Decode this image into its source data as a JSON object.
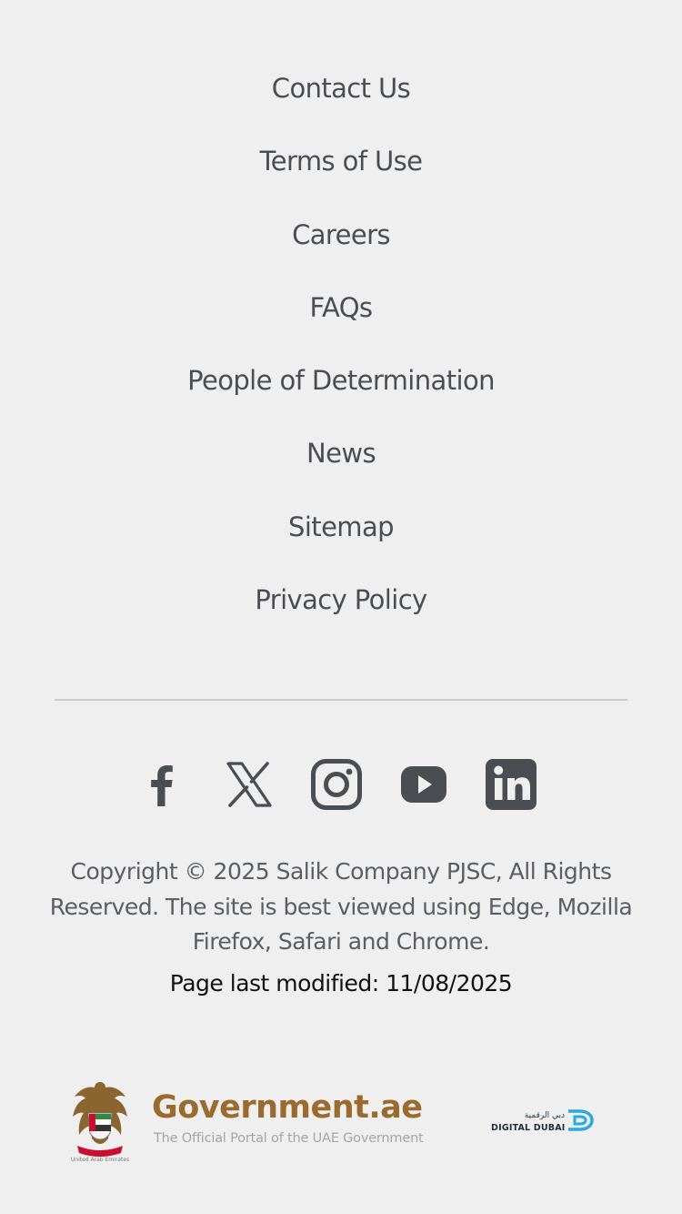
{
  "footer_links": [
    {
      "label": "Contact Us"
    },
    {
      "label": "Terms of Use"
    },
    {
      "label": "Careers"
    },
    {
      "label": "FAQs"
    },
    {
      "label": "People of Determination"
    },
    {
      "label": "News"
    },
    {
      "label": "Sitemap"
    },
    {
      "label": "Privacy Policy"
    }
  ],
  "social": {
    "icons": [
      "facebook-icon",
      "x-icon",
      "instagram-icon",
      "youtube-icon",
      "linkedin-icon"
    ],
    "color": "#4a4d52"
  },
  "copyright": "Copyright © 2025 Salik Company PJSC, All Rights Reserved. The site is best viewed using Edge, Mozilla Firefox, Safari and Chrome.",
  "last_modified": "Page last modified: 11/08/2025",
  "gov_logo": {
    "title": "Government.ae",
    "subtitle": "The Official Portal of the UAE Government",
    "emblem_caption": "United Arab Emirates",
    "color": "#9a6a2e"
  },
  "digital_dubai": {
    "arabic": "دبي الرقمية",
    "label": "DIGITAL DUBAI",
    "color": "#29a9e1"
  }
}
